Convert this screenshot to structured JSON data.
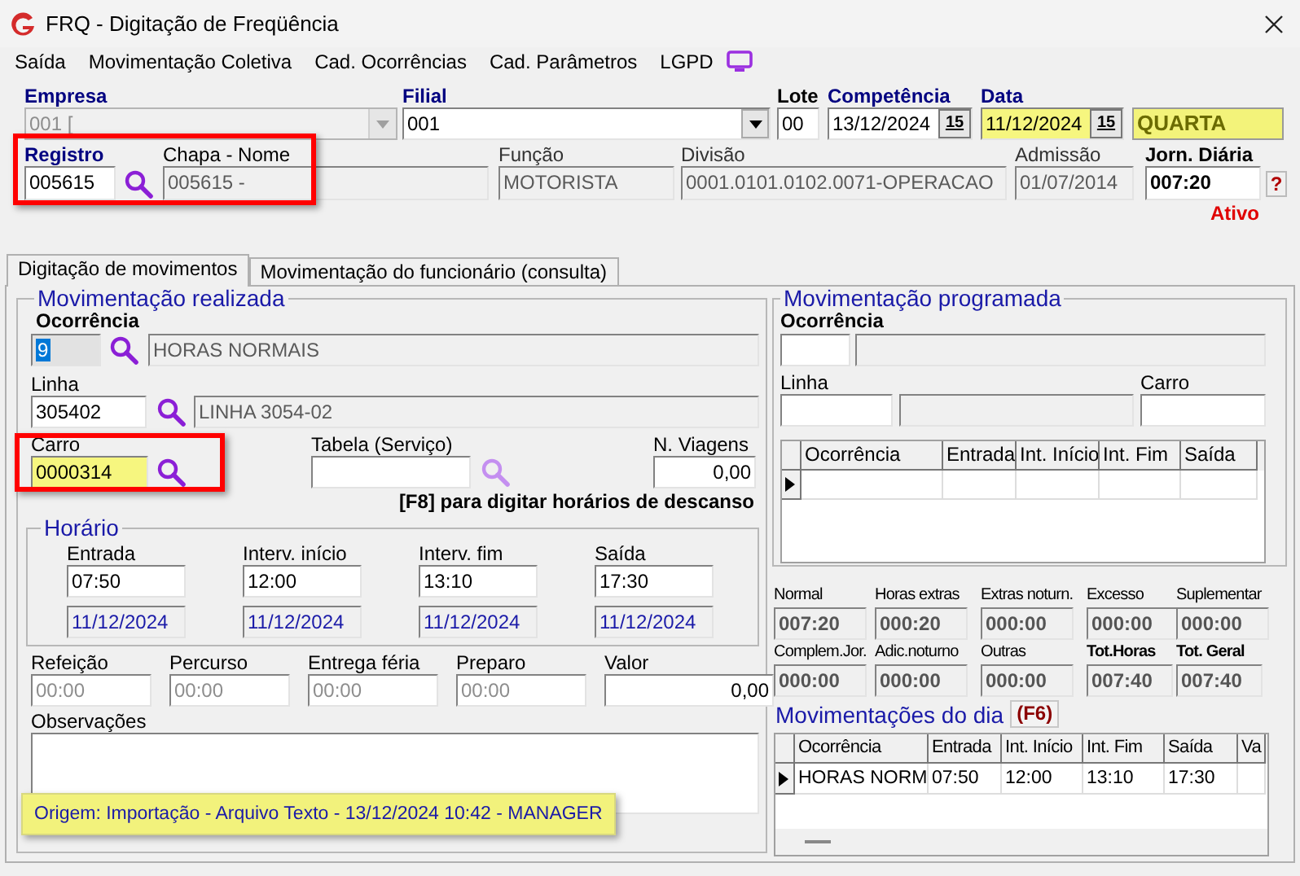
{
  "window": {
    "title": "FRQ - Digitação de Freqüência"
  },
  "menu": [
    {
      "label": "Saída"
    },
    {
      "label": "Movimentação Coletiva"
    },
    {
      "label": "Cad. Ocorrências"
    },
    {
      "label": "Cad. Parâmetros"
    },
    {
      "label": "LGPD"
    }
  ],
  "empresa": {
    "label": "Empresa",
    "value": "001 [",
    "disabled": true
  },
  "filial": {
    "label": "Filial",
    "value": "001"
  },
  "lote": {
    "label": "Lote",
    "value": "00"
  },
  "competencia": {
    "label": "Competência",
    "value": "13/12/2024",
    "button": "15",
    "highlighted": false
  },
  "data": {
    "label": "Data",
    "value": "11/12/2024",
    "button": "15",
    "highlighted": true,
    "weekday": "QUARTA"
  },
  "registro": {
    "label": "Registro",
    "value": "005615"
  },
  "chapa_nome": {
    "label": "Chapa  -  Nome",
    "value": "005615 -"
  },
  "funcao": {
    "label": "Função",
    "value": "MOTORISTA"
  },
  "divisao": {
    "label": "Divisão",
    "value": "0001.0101.0102.0071-OPERACAO"
  },
  "admissao": {
    "label": "Admissão",
    "value": "01/07/2014"
  },
  "jornada": {
    "label": "Jorn. Diária",
    "value": "007:20",
    "help": "?",
    "status": "Ativo"
  },
  "tabs": [
    {
      "label": "Digitação de movimentos",
      "selected": true
    },
    {
      "label": "Movimentação do funcionário (consulta)",
      "selected": false
    }
  ],
  "realizada": {
    "title": "Movimentação realizada",
    "ocorrencia": {
      "label": "Ocorrência",
      "code": "9",
      "description": "HORAS NORMAIS"
    },
    "linha": {
      "label": "Linha",
      "code": "305402",
      "description": "LINHA 3054-02"
    },
    "carro": {
      "label": "Carro",
      "value": "0000314",
      "highlighted": true
    },
    "tabela": {
      "label": "Tabela (Serviço)",
      "search_disabled": true
    },
    "viagens": {
      "label": "N. Viagens",
      "value": "0,00"
    },
    "hint": "[F8] para digitar horários de descanso",
    "horario": {
      "title": "Horário",
      "columns": [
        {
          "label": "Entrada",
          "time": "07:50",
          "date": "11/12/2024"
        },
        {
          "label": "Interv. início",
          "time": "12:00",
          "date": "11/12/2024"
        },
        {
          "label": "Interv. fim",
          "time": "13:10",
          "date": "11/12/2024"
        },
        {
          "label": "Saída",
          "time": "17:30",
          "date": "11/12/2024"
        }
      ]
    },
    "extras": [
      {
        "label": "Refeição",
        "value": "00:00",
        "kind": "time"
      },
      {
        "label": "Percurso",
        "value": "00:00",
        "kind": "time"
      },
      {
        "label": "Entrega féria",
        "value": "00:00",
        "kind": "time"
      },
      {
        "label": "Preparo",
        "value": "00:00",
        "kind": "time"
      },
      {
        "label": "Valor",
        "value": "0,00",
        "kind": "number"
      }
    ],
    "observacoes": {
      "label": "Observações"
    },
    "tooltip": "Origem: Importação - Arquivo Texto - 13/12/2024 10:42 - MANAGER"
  },
  "programada": {
    "title": "Movimentação programada",
    "ocorrencia_label": "Ocorrência",
    "linha_label": "Linha",
    "carro_label": "Carro",
    "columns": [
      "Ocorrência",
      "Entrada",
      "Int. Início",
      "Int. Fim",
      "Saída"
    ]
  },
  "totals": [
    {
      "label": "Normal",
      "value": "007:20",
      "bold": false
    },
    {
      "label": "Horas extras",
      "value": "000:20",
      "bold": false
    },
    {
      "label": "Extras noturn.",
      "value": "000:00",
      "bold": false
    },
    {
      "label": "Excesso",
      "value": "000:00",
      "bold": false
    },
    {
      "label": "Suplementar",
      "value": "000:00",
      "bold": false
    },
    {
      "label": "Complem.Jor.",
      "value": "000:00",
      "bold": false
    },
    {
      "label": "Adic.noturno",
      "value": "000:00",
      "bold": false
    },
    {
      "label": "Outras",
      "value": "000:00",
      "bold": false
    },
    {
      "label": "Tot.Horas",
      "value": "007:40",
      "bold": true
    },
    {
      "label": "Tot. Geral",
      "value": "007:40",
      "bold": true
    }
  ],
  "movimentacoes_dia": {
    "title": "Movimentações do dia",
    "shortcut": "(F6)",
    "columns": [
      "Ocorrência",
      "Entrada",
      "Int. Início",
      "Int. Fim",
      "Saída",
      "Va"
    ],
    "rows": [
      {
        "cells": [
          "HORAS NORM",
          "07:50",
          "12:00",
          "13:10",
          "17:30"
        ]
      }
    ]
  }
}
